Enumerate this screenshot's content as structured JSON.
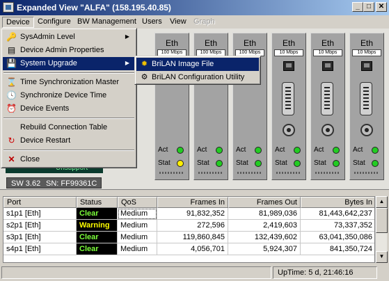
{
  "window": {
    "title": "Expanded View \"ALFA\" (158.195.40.85)",
    "buttons": {
      "minimize": "_",
      "maximize": "□",
      "close": "✕"
    }
  },
  "menubar": [
    "Device",
    "Configure",
    "BW Management",
    "Users",
    "View",
    "Graph"
  ],
  "device_menu": {
    "items": [
      {
        "label": "SysAdmin Level",
        "icon": "key-icon",
        "submenu": true
      },
      {
        "label": "Device Admin Properties",
        "icon": "properties-icon"
      },
      {
        "label": "System Upgrade",
        "icon": "floppy-icon",
        "submenu": true,
        "highlighted": true
      },
      {
        "label": "Time Synchronization Master",
        "icon": "hourglass-icon"
      },
      {
        "label": "Synchronize Device Time",
        "icon": "clock-icon"
      },
      {
        "label": "Device Events",
        "icon": "alarm-icon"
      },
      {
        "label": "Rebuild Connection Table",
        "icon": ""
      },
      {
        "label": "Device Restart",
        "icon": "restart-icon"
      },
      {
        "label": "Close",
        "icon": "close-x-icon"
      }
    ]
  },
  "submenu": {
    "items": [
      {
        "label": "BriLAN Image File",
        "icon": "gear-icon",
        "highlighted": true
      },
      {
        "label": "BriLAN Configuration Utility",
        "icon": "config-icon"
      }
    ]
  },
  "slots": [
    {
      "label": "Eth",
      "speed": "100 Mbps",
      "act": "Act",
      "stat": "Stat",
      "act_color": "#22cc22",
      "stat_color": "#ffee00"
    },
    {
      "label": "Eth",
      "speed": "100 Mbps",
      "act": "Act",
      "stat": "Stat",
      "act_color": "#22cc22",
      "stat_color": "#22cc22"
    },
    {
      "label": "Eth",
      "speed": "100 Mbps",
      "act": "Act",
      "stat": "Stat",
      "act_color": "#22cc22",
      "stat_color": "#22cc22"
    },
    {
      "label": "Eth",
      "speed": "10 Mbps",
      "act": "Act",
      "stat": "Stat",
      "act_color": "#22cc22",
      "stat_color": "#22cc22"
    },
    {
      "label": "Eth",
      "speed": "10 Mbps",
      "act": "Act",
      "stat": "Stat",
      "act_color": "#22cc22",
      "stat_color": "#22cc22"
    },
    {
      "label": "Eth",
      "speed": "10 Mbps",
      "act": "Act",
      "stat": "Stat",
      "act_color": "#22cc22",
      "stat_color": "#22cc22"
    }
  ],
  "unit": {
    "panel_text": "Unsupport",
    "sw": "SW 3.62",
    "sn": "SN: FF99361C"
  },
  "table": {
    "columns": [
      "Port",
      "Status",
      "QoS",
      "Frames In",
      "Frames Out",
      "Bytes In"
    ],
    "rows": [
      {
        "port": "s1p1  [Eth]",
        "status": "Clear",
        "qos": "Medium",
        "frames_in": "91,832,352",
        "frames_out": "81,989,036",
        "bytes_in": "81,443,642,237"
      },
      {
        "port": "s2p1  [Eth]",
        "status": "Warning",
        "qos": "Medium",
        "frames_in": "272,596",
        "frames_out": "2,419,603",
        "bytes_in": "73,337,352"
      },
      {
        "port": "s3p1  [Eth]",
        "status": "Clear",
        "qos": "Medium",
        "frames_in": "119,860,845",
        "frames_out": "132,439,602",
        "bytes_in": "63,041,350,086"
      },
      {
        "port": "s4p1  [Eth]",
        "status": "Clear",
        "qos": "Medium",
        "frames_in": "4,056,701",
        "frames_out": "5,924,307",
        "bytes_in": "841,350,724"
      }
    ]
  },
  "statusbar": {
    "uptime": "UpTime:  5 d, 21:46:16"
  }
}
